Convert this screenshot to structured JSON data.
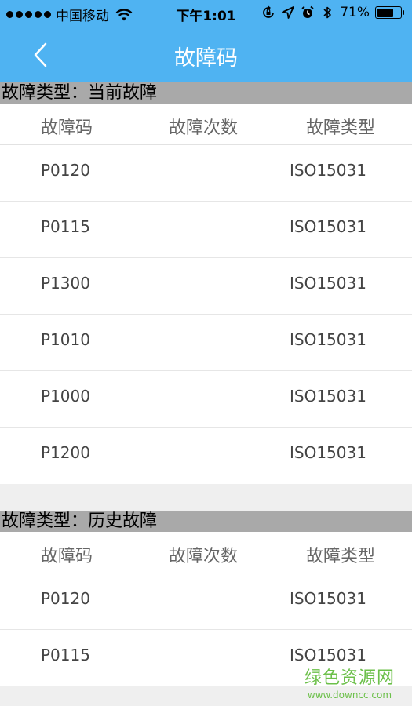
{
  "status_bar": {
    "carrier": "中国移动",
    "time": "下午1:01",
    "battery": "71%",
    "battery_level": 0.71,
    "icons": [
      "signal-dots-icon",
      "wifi-icon",
      "orientation-lock-icon",
      "location-icon",
      "alarm-icon",
      "bluetooth-icon",
      "battery-icon"
    ]
  },
  "nav": {
    "title": "故障码",
    "back_icon": "chevron-left-icon"
  },
  "colors": {
    "nav_bg": "#4fb3f2",
    "section_header_bg": "#a9a9a9",
    "watermark": "#6cc04a"
  },
  "sections": [
    {
      "title": "故障类型：当前故障",
      "columns": [
        "故障码",
        "故障次数",
        "故障类型"
      ],
      "rows": [
        {
          "code": "P0120",
          "count": "",
          "type": "ISO15031"
        },
        {
          "code": "P0115",
          "count": "",
          "type": "ISO15031"
        },
        {
          "code": "P1300",
          "count": "",
          "type": "ISO15031"
        },
        {
          "code": "P1010",
          "count": "",
          "type": "ISO15031"
        },
        {
          "code": "P1000",
          "count": "",
          "type": "ISO15031"
        },
        {
          "code": "P1200",
          "count": "",
          "type": "ISO15031"
        }
      ]
    },
    {
      "title": "故障类型：历史故障",
      "columns": [
        "故障码",
        "故障次数",
        "故障类型"
      ],
      "rows": [
        {
          "code": "P0120",
          "count": "",
          "type": "ISO15031"
        },
        {
          "code": "P0115",
          "count": "",
          "type": "ISO15031"
        }
      ]
    }
  ],
  "watermark": {
    "main": "绿色资源网",
    "sub": "www.downcc.com"
  }
}
